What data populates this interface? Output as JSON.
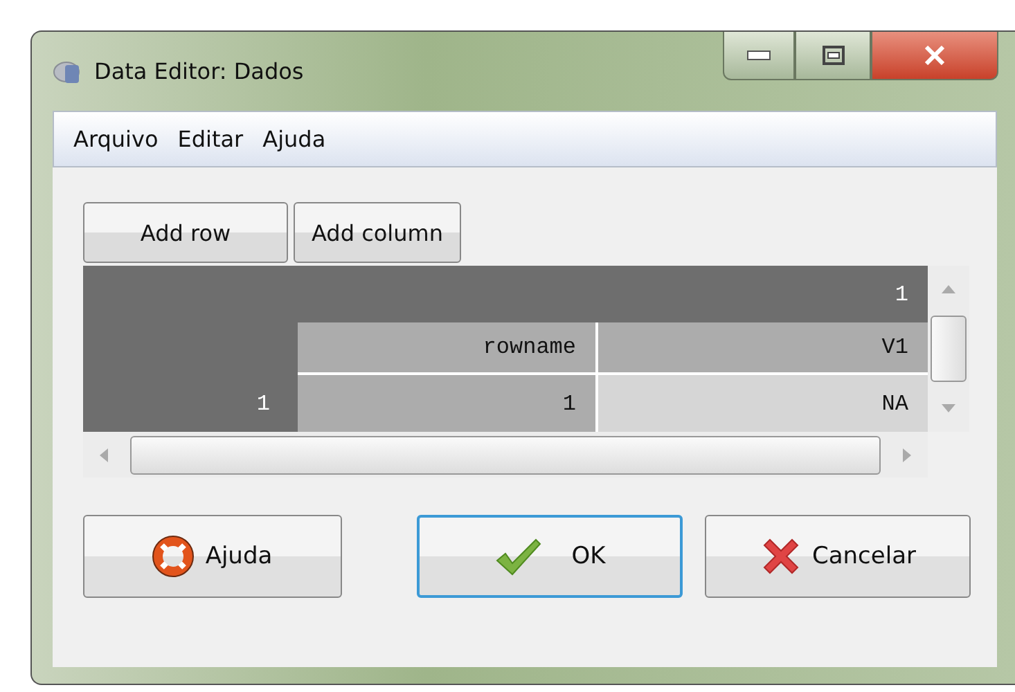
{
  "window": {
    "title": "Data Editor: Dados"
  },
  "menu": [
    {
      "label": "Arquivo"
    },
    {
      "label": "Editar"
    },
    {
      "label": "Ajuda"
    }
  ],
  "toolbar": [
    {
      "label": "Add row"
    },
    {
      "label": "Add column"
    }
  ],
  "table": {
    "top_header": "1",
    "columns": [
      "rowname",
      "V1"
    ],
    "rows": [
      {
        "label": "1",
        "cells": [
          "1",
          "NA"
        ]
      }
    ]
  },
  "buttons": [
    {
      "label": "Ajuda",
      "kind": "help",
      "focused": false
    },
    {
      "label": "OK",
      "kind": "ok",
      "focused": true
    },
    {
      "label": "Cancelar",
      "kind": "cancel",
      "focused": false
    }
  ]
}
